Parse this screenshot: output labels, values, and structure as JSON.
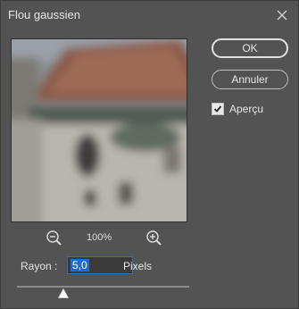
{
  "dialog": {
    "title": "Flou gaussien"
  },
  "buttons": {
    "ok": "OK",
    "cancel": "Annuler"
  },
  "preview_option": {
    "label": "Aperçu",
    "checked": true
  },
  "zoom": {
    "level": "100%"
  },
  "radius": {
    "label": "Rayon :",
    "value": "5,0",
    "unit": "Pixels",
    "slider_fraction": 0.27
  },
  "icons": {
    "close": "close-icon",
    "zoom_out": "zoom-out-icon",
    "zoom_in": "zoom-in-icon",
    "check": "check-icon"
  },
  "colors": {
    "accent": "#1f6bd6",
    "dialog_bg": "#535353"
  }
}
